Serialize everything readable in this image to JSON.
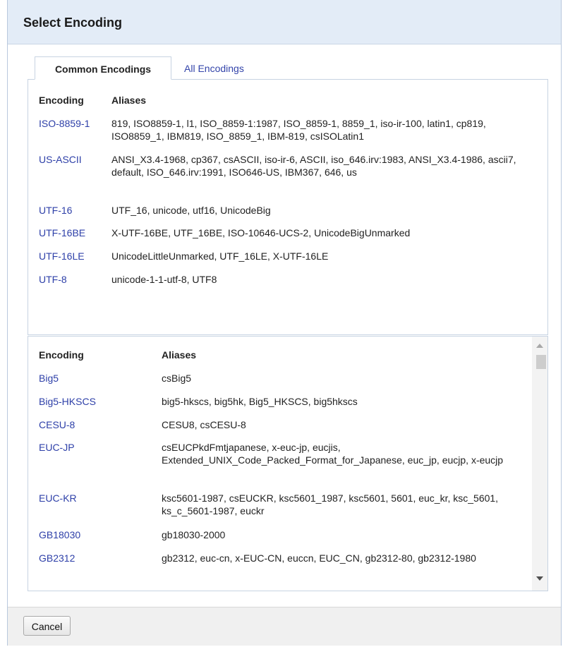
{
  "dialog": {
    "title": "Select Encoding",
    "tabs": [
      {
        "label": "Common Encodings",
        "active": true
      },
      {
        "label": "All Encodings",
        "active": false
      }
    ],
    "cancel_label": "Cancel"
  },
  "common": {
    "header_encoding": "Encoding",
    "header_aliases": "Aliases",
    "rows": [
      {
        "encoding": "ISO-8859-1",
        "aliases": "819, ISO8859-1, l1, ISO_8859-1:1987, ISO_8859-1, 8859_1, iso-ir-100, latin1, cp819, ISO8859_1, IBM819, ISO_8859_1, IBM-819, csISOLatin1"
      },
      {
        "encoding": "US-ASCII",
        "aliases": "ANSI_X3.4-1968, cp367, csASCII, iso-ir-6, ASCII, iso_646.irv:1983, ANSI_X3.4-1986, ascii7, default, ISO_646.irv:1991, ISO646-US, IBM367, 646, us"
      },
      {
        "encoding": "UTF-16",
        "aliases": "UTF_16, unicode, utf16, UnicodeBig"
      },
      {
        "encoding": "UTF-16BE",
        "aliases": "X-UTF-16BE, UTF_16BE, ISO-10646-UCS-2, UnicodeBigUnmarked"
      },
      {
        "encoding": "UTF-16LE",
        "aliases": "UnicodeLittleUnmarked, UTF_16LE, X-UTF-16LE"
      },
      {
        "encoding": "UTF-8",
        "aliases": "unicode-1-1-utf-8, UTF8"
      }
    ]
  },
  "all": {
    "header_encoding": "Encoding",
    "header_aliases": "Aliases",
    "rows": [
      {
        "encoding": "Big5",
        "aliases": "csBig5"
      },
      {
        "encoding": "Big5-HKSCS",
        "aliases": "big5-hkscs, big5hk, Big5_HKSCS, big5hkscs"
      },
      {
        "encoding": "CESU-8",
        "aliases": "CESU8, csCESU-8"
      },
      {
        "encoding": "EUC-JP",
        "aliases": "csEUCPkdFmtjapanese, x-euc-jp, eucjis, Extended_UNIX_Code_Packed_Format_for_Japanese, euc_jp, eucjp, x-eucjp"
      },
      {
        "encoding": "EUC-KR",
        "aliases": "ksc5601-1987, csEUCKR, ksc5601_1987, ksc5601, 5601, euc_kr, ksc_5601, ks_c_5601-1987, euckr"
      },
      {
        "encoding": "GB18030",
        "aliases": "gb18030-2000"
      },
      {
        "encoding": "GB2312",
        "aliases": "gb2312, euc-cn, x-EUC-CN, euccn, EUC_CN, gb2312-80, gb2312-1980"
      }
    ]
  }
}
